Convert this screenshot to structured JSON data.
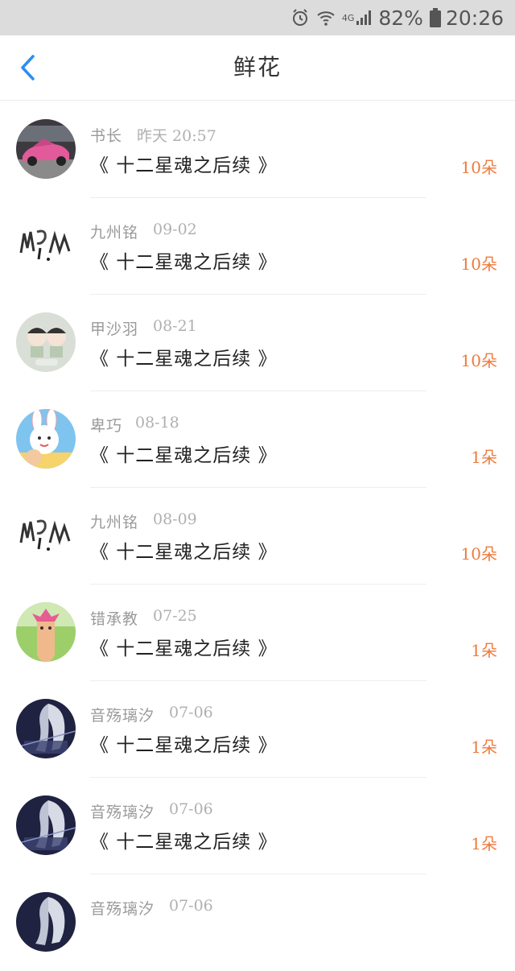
{
  "status_bar": {
    "battery_percent": "82%",
    "time": "20:26",
    "icons": [
      "alarm-icon",
      "wifi-icon",
      "4g-signal-icon",
      "battery-icon"
    ],
    "network_label": "4G"
  },
  "header": {
    "title": "鲜花",
    "back_icon": "chevron-left-icon",
    "accent_color": "#2b8ef0"
  },
  "colors": {
    "count": "#ef7a3d",
    "meta": "#9a9a9a",
    "title": "#222222"
  },
  "items": [
    {
      "name": "书长",
      "date": "昨天 20:57",
      "title": "《 十二星魂之后续 》",
      "count": "10朵",
      "avatar": "car-photo-avatar"
    },
    {
      "name": "九州铭",
      "date": "09-02",
      "title": "《 十二星魂之后续 》",
      "count": "10朵",
      "avatar": "ink-calligraphy-avatar"
    },
    {
      "name": "甲沙羽",
      "date": "08-21",
      "title": "《 十二星魂之后续 》",
      "count": "10朵",
      "avatar": "chibi-dolls-avatar"
    },
    {
      "name": "卑巧",
      "date": "08-18",
      "title": "《 十二星魂之后续 》",
      "count": "1朵",
      "avatar": "bunny-cartoon-avatar"
    },
    {
      "name": "九州铭",
      "date": "08-09",
      "title": "《 十二星魂之后续 》",
      "count": "10朵",
      "avatar": "ink-calligraphy-avatar"
    },
    {
      "name": "错承教",
      "date": "07-25",
      "title": "《 十二星魂之后续 》",
      "count": "1朵",
      "avatar": "finger-puppet-avatar"
    },
    {
      "name": "音殇璃汐",
      "date": "07-06",
      "title": "《 十二星魂之后续 》",
      "count": "1朵",
      "avatar": "anime-silver-hair-avatar"
    },
    {
      "name": "音殇璃汐",
      "date": "07-06",
      "title": "《 十二星魂之后续 》",
      "count": "1朵",
      "avatar": "anime-silver-hair-avatar"
    },
    {
      "name": "音殇璃汐",
      "date": "07-06",
      "title": "",
      "count": "",
      "avatar": "anime-silver-hair-avatar"
    }
  ]
}
